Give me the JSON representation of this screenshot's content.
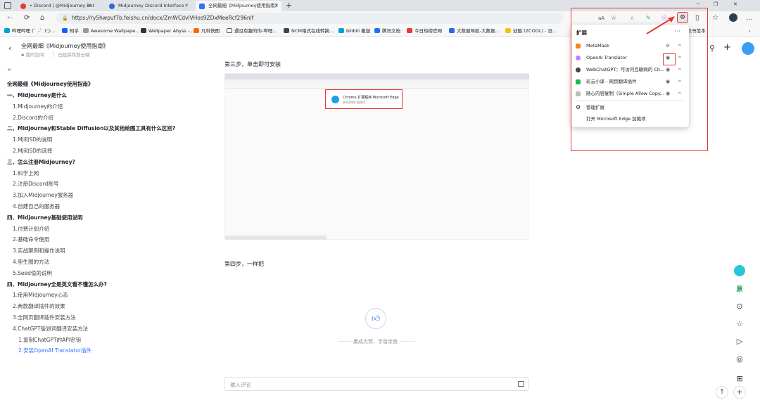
{
  "browser": {
    "tabs": [
      {
        "label": "• Discord | @Midjourney Bot",
        "color": "#5865f2"
      },
      {
        "label": "Midjourney Discord Interface",
        "color": "#2a6bdb"
      },
      {
        "label": "全网最细《Midjourney使用指南》",
        "color": "#3370ff"
      }
    ],
    "new_tab": "+",
    "window_controls": [
      "─",
      "❐",
      "✕"
    ],
    "url": "https://ry5hwpuf7b.feishu.cn/docx/ZmWCdvlVHos9ZDxMeeRcf296nlf",
    "bookmarks": [
      "哔哩哔哩 (゜-゜)つ...",
      "知乎",
      "Awesome Wallpape...",
      "Wallpaper Abyss -...",
      "凡科快图",
      "遇见有趣的你-哔哩...",
      "NCM格式在线转换...",
      "bilibili 搬迦",
      "腾讯文档",
      "今日热榜官网",
      "大数据导航-大数据...",
      "幼酷 (ZCOOL) - 设...",
      "协议书范本"
    ],
    "nav_icons": [
      "←",
      "⟳",
      "⌂"
    ],
    "toolbar_icons": [
      "aA",
      "☆",
      "ʌ",
      "✎",
      "◎",
      "⚙",
      "▯",
      "☆",
      "⊕",
      "…"
    ]
  },
  "doc": {
    "title": "全网最细《Midjourney使用指南》",
    "star": "☆",
    "breadcrumb_space": "我的空间",
    "breadcrumb_status": "已经保存到云端",
    "header_icons": [
      "🔍",
      "+"
    ]
  },
  "toc": {
    "collapse": "《",
    "title": "全网最细《Midjourney使用指南》",
    "items": [
      {
        "text": "一、Midjourney是什么",
        "level": "sec"
      },
      {
        "text": "1.Midjourney的介绍",
        "level": "sub"
      },
      {
        "text": "2.Discord的介绍",
        "level": "sub"
      },
      {
        "text": "二、Midjourney和Stable Diffusion以及其他绘图工具有什么区别?",
        "level": "sec"
      },
      {
        "text": "1.MJ和SD的说明",
        "level": "sub"
      },
      {
        "text": "2.MJ和SD的选择",
        "level": "sub"
      },
      {
        "text": "三、怎么注册Midjourney?",
        "level": "sec"
      },
      {
        "text": "1.科学上网",
        "level": "sub"
      },
      {
        "text": "2.注册Discord账号",
        "level": "sub"
      },
      {
        "text": "3.加入Midjourney服务器",
        "level": "sub"
      },
      {
        "text": "4.创建自己的服务器",
        "level": "sub"
      },
      {
        "text": "四、Midjourney基础使用说明",
        "level": "sec"
      },
      {
        "text": "1.付费计划介绍",
        "level": "sub"
      },
      {
        "text": "2.基础命令使用",
        "level": "sub"
      },
      {
        "text": "3.实战案例和操作说明",
        "level": "sub"
      },
      {
        "text": "4.垫生图的方法",
        "level": "sub"
      },
      {
        "text": "5.Seed值的说明",
        "level": "sub"
      },
      {
        "text": "四、Midjourney全是英文看不懂怎么办?",
        "level": "sec"
      },
      {
        "text": "1.使用Midjourney心态",
        "level": "sub"
      },
      {
        "text": "2.两款翻译插件的效果",
        "level": "sub"
      },
      {
        "text": "3.全网页翻译插件安装方法",
        "level": "sub"
      },
      {
        "text": "4.ChatGPT版划词翻译安装方法",
        "level": "sub"
      },
      {
        "text": "1.复制ChatGPT的API密钥",
        "level": "sub2"
      },
      {
        "text": "2.安装OpenAI Translator插件",
        "level": "sub2 active"
      }
    ]
  },
  "content": {
    "step3": "第三步，单击即可安装",
    "step4": "第四步，一样把",
    "install_banner_title": "Chrome 扩展程序 Microsoft Edge",
    "install_banner_sub": "单击获取扩展程序",
    "like_text": "赢成点赞、手留余香",
    "comment_placeholder": "输入评论"
  },
  "extensions_popup": {
    "title": "扩展",
    "more": "···",
    "items": [
      {
        "name": "MetaMask",
        "color": "#f6851b",
        "eye": "◎̸"
      },
      {
        "name": "OpenAI Translator",
        "color": "#c77dff",
        "eye": "◉"
      },
      {
        "name": "WebChatGPT：可访问互联网的 Ch...",
        "color": "#444",
        "eye": "◉"
      },
      {
        "name": "彩云小译 - 网页翻译插件",
        "color": "#1db954",
        "eye": "◉"
      },
      {
        "name": "随心内容复制（Simple Allow Copy...",
        "color": "#bbb",
        "eye": "◉"
      }
    ],
    "manage": "管理扩展",
    "open_store": "打开 Microsoft Edge 加载项"
  },
  "right_sidebar": {
    "icons": [
      "☺",
      "原",
      "⊙",
      "☆",
      "▷",
      "◎",
      "⊞"
    ]
  },
  "scroll_up": "↑",
  "add_button": "+"
}
